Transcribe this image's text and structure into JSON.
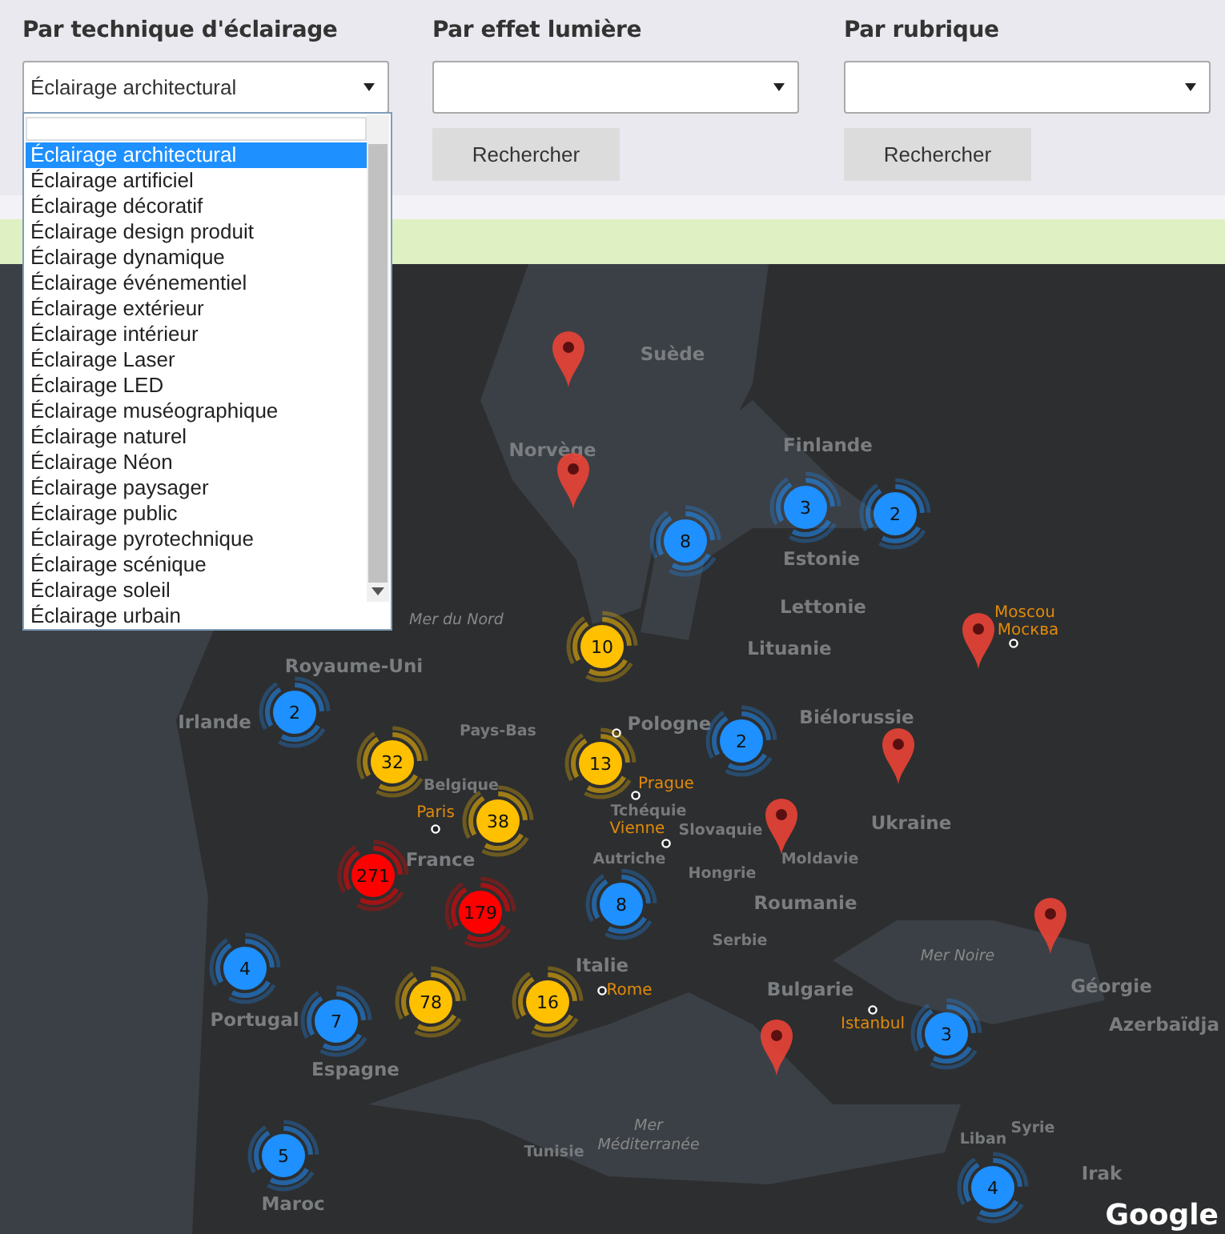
{
  "filters": [
    {
      "label": "Par technique d'éclairage",
      "value": "Éclairage architectural",
      "open": true
    },
    {
      "label": "Par effet lumière",
      "open": false,
      "button": "Rechercher"
    },
    {
      "label": "Par rubrique",
      "open": false,
      "button": "Rechercher"
    }
  ],
  "dropdown": {
    "options": [
      {
        "label": "Éclairage architectural",
        "selected": true
      },
      {
        "label": "Éclairage artificiel",
        "selected": false
      },
      {
        "label": "Éclairage décoratif",
        "selected": false
      },
      {
        "label": "Éclairage design produit",
        "selected": false
      },
      {
        "label": "Éclairage dynamique",
        "selected": false
      },
      {
        "label": "Éclairage événementiel",
        "selected": false
      },
      {
        "label": "Éclairage extérieur",
        "selected": false
      },
      {
        "label": "Éclairage intérieur",
        "selected": false
      },
      {
        "label": "Éclairage Laser",
        "selected": false
      },
      {
        "label": "Éclairage LED",
        "selected": false
      },
      {
        "label": "Éclairage muséographique",
        "selected": false
      },
      {
        "label": "Éclairage naturel",
        "selected": false
      },
      {
        "label": "Éclairage Néon",
        "selected": false
      },
      {
        "label": "Éclairage paysager",
        "selected": false
      },
      {
        "label": "Éclairage public",
        "selected": false
      },
      {
        "label": "Éclairage pyrotechnique",
        "selected": false
      },
      {
        "label": "Éclairage scénique",
        "selected": false
      },
      {
        "label": "Éclairage soleil",
        "selected": false
      },
      {
        "label": "Éclairage urbain",
        "selected": false
      }
    ]
  },
  "map": {
    "labels": [
      {
        "text": "Suède",
        "kind": "country"
      },
      {
        "text": "Norvège",
        "kind": "country"
      },
      {
        "text": "Finlande",
        "kind": "country"
      },
      {
        "text": "Estonie",
        "kind": "country"
      },
      {
        "text": "Lettonie",
        "kind": "country"
      },
      {
        "text": "Lituanie",
        "kind": "country"
      },
      {
        "text": "Biélorussie",
        "kind": "country"
      },
      {
        "text": "Pologne",
        "kind": "country"
      },
      {
        "text": "Royaume-Uni",
        "kind": "country"
      },
      {
        "text": "Irlande",
        "kind": "country"
      },
      {
        "text": "Pays-Bas",
        "kind": "small"
      },
      {
        "text": "Belgique",
        "kind": "small"
      },
      {
        "text": "Tchéquie",
        "kind": "small"
      },
      {
        "text": "Slovaquie",
        "kind": "small"
      },
      {
        "text": "Autriche",
        "kind": "small"
      },
      {
        "text": "Hongrie",
        "kind": "small"
      },
      {
        "text": "France",
        "kind": "country"
      },
      {
        "text": "Moldavie",
        "kind": "small"
      },
      {
        "text": "Ukraine",
        "kind": "country"
      },
      {
        "text": "Roumanie",
        "kind": "country"
      },
      {
        "text": "Serbie",
        "kind": "small"
      },
      {
        "text": "Italie",
        "kind": "country"
      },
      {
        "text": "Bulgarie",
        "kind": "country"
      },
      {
        "text": "Portugal",
        "kind": "country"
      },
      {
        "text": "Espagne",
        "kind": "country"
      },
      {
        "text": "Géorgie",
        "kind": "country"
      },
      {
        "text": "Azerbaïdja",
        "kind": "country"
      },
      {
        "text": "Syrie",
        "kind": "small"
      },
      {
        "text": "Liban",
        "kind": "small"
      },
      {
        "text": "Irak",
        "kind": "country"
      },
      {
        "text": "Tunisie",
        "kind": "small"
      },
      {
        "text": "Maroc",
        "kind": "country"
      },
      {
        "text": "Mer du Nord",
        "kind": "sea"
      },
      {
        "text": "Mer Noire",
        "kind": "sea"
      },
      {
        "text": "Mer Méditerranée",
        "kind": "sea"
      },
      {
        "text": "Moscou",
        "kind": "city"
      },
      {
        "text": "Москва",
        "kind": "city"
      },
      {
        "text": "Paris",
        "kind": "city"
      },
      {
        "text": "Prague",
        "kind": "city"
      },
      {
        "text": "Vienne",
        "kind": "city"
      },
      {
        "text": "Rome",
        "kind": "city"
      },
      {
        "text": "Istanbul",
        "kind": "city"
      }
    ],
    "clusters": [
      {
        "count": "8",
        "color": "#1e90ff"
      },
      {
        "count": "3",
        "color": "#1e90ff"
      },
      {
        "count": "2",
        "color": "#1e90ff"
      },
      {
        "count": "10",
        "color": "#ffc000"
      },
      {
        "count": "2",
        "color": "#1e90ff"
      },
      {
        "count": "32",
        "color": "#ffc000"
      },
      {
        "count": "13",
        "color": "#ffc000"
      },
      {
        "count": "2",
        "color": "#1e90ff"
      },
      {
        "count": "38",
        "color": "#ffc000"
      },
      {
        "count": "271",
        "color": "#ff0000"
      },
      {
        "count": "179",
        "color": "#ff0000"
      },
      {
        "count": "8",
        "color": "#1e90ff"
      },
      {
        "count": "4",
        "color": "#1e90ff"
      },
      {
        "count": "7",
        "color": "#1e90ff"
      },
      {
        "count": "78",
        "color": "#ffc000"
      },
      {
        "count": "16",
        "color": "#ffc000"
      },
      {
        "count": "3",
        "color": "#1e90ff"
      },
      {
        "count": "5",
        "color": "#1e90ff"
      },
      {
        "count": "4",
        "color": "#1e90ff"
      }
    ],
    "brand": "Google"
  }
}
